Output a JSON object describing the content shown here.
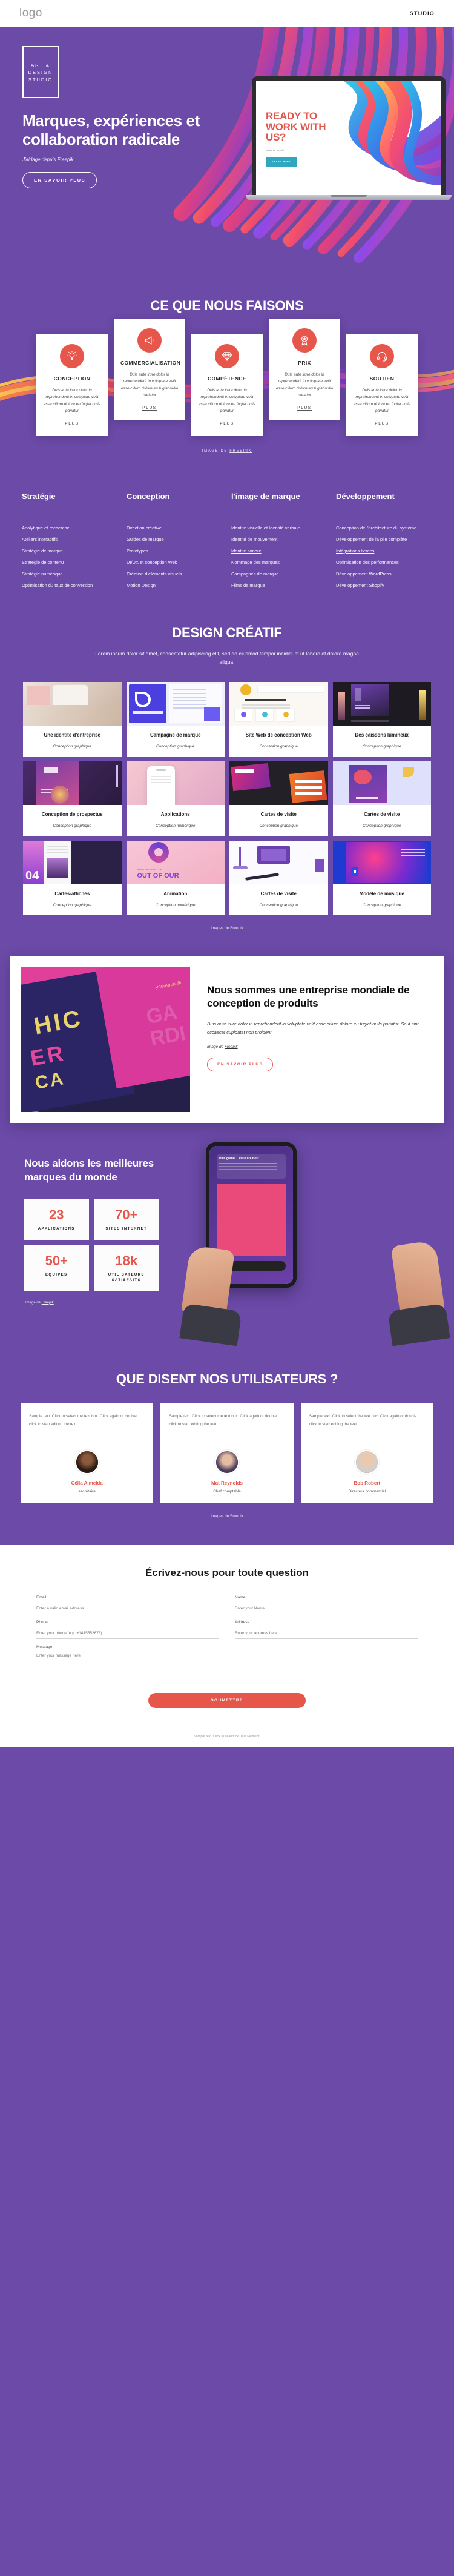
{
  "topbar": {
    "logo": "logo",
    "nav": "STUDIO"
  },
  "hero": {
    "badge": [
      "ART &",
      "DESIGN",
      "STUDIO"
    ],
    "title": "Marques, expériences et collaboration radicale",
    "credit_prefix": "J'aidage depuis ",
    "credit_link": "Freepik",
    "cta": "EN SAVOIR PLUS",
    "screen_title": "READY TO WORK WITH US?",
    "screen_sub": "image for freepik",
    "screen_btn": "LEARN MORE"
  },
  "services": {
    "title": "CE QUE NOUS FAISONS",
    "credit_prefix": "IMAGE DE ",
    "credit_link": "FREEPIK",
    "more_label": "PLUS",
    "body": "Duis aute irure dolor in reprehenderit in voluptate velit esse cillum dolore eu fugiat nulla pariatur",
    "items": [
      {
        "name": "CONCEPTION",
        "icon": "lightbulb-icon"
      },
      {
        "name": "COMMERCIALISATION",
        "icon": "megaphone-icon"
      },
      {
        "name": "COMPÉTENCE",
        "icon": "diamond-icon"
      },
      {
        "name": "PRIX",
        "icon": "award-icon"
      },
      {
        "name": "SOUTIEN",
        "icon": "headset-icon"
      }
    ]
  },
  "menus": [
    {
      "heading": "Stratégie",
      "items": [
        {
          "label": "Analytique et recherche",
          "link": false
        },
        {
          "label": "Ateliers interactifs",
          "link": false
        },
        {
          "label": "Stratégie de marque",
          "link": false
        },
        {
          "label": "Stratégie de contenu",
          "link": false
        },
        {
          "label": "Stratégie numérique",
          "link": false
        },
        {
          "label": "Optimisation du taux de conversion",
          "link": true
        }
      ]
    },
    {
      "heading": "Conception",
      "items": [
        {
          "label": "Direction créative",
          "link": false
        },
        {
          "label": "Guides de marque",
          "link": false
        },
        {
          "label": "Prototypes",
          "link": false
        },
        {
          "label": "UI/UX et conception Web",
          "link": true
        },
        {
          "label": "Création d'éléments visuels",
          "link": false
        },
        {
          "label": "Motion Design",
          "link": false
        }
      ]
    },
    {
      "heading": "l'image de marque",
      "items": [
        {
          "label": "Identité visuelle et Identité verbale",
          "link": false
        },
        {
          "label": "Identité de mouvement",
          "link": false
        },
        {
          "label": "Identité sonore",
          "link": true
        },
        {
          "label": "Nommage des marques",
          "link": false
        },
        {
          "label": "Campagnes de marque",
          "link": false
        },
        {
          "label": "Films de marque",
          "link": false
        }
      ]
    },
    {
      "heading": "Développement",
      "items": [
        {
          "label": "Conception de l'architecture du système",
          "link": false
        },
        {
          "label": "Développement de la pile complète",
          "link": false
        },
        {
          "label": "Intégrations tierces",
          "link": true
        },
        {
          "label": "Optimisation des performances",
          "link": false
        },
        {
          "label": "Développement WordPress",
          "link": false
        },
        {
          "label": "Développement Shopify",
          "link": false
        }
      ]
    }
  ],
  "portfolio": {
    "title": "DESIGN CRÉATIF",
    "subtitle": "Lorem ipsum dolor sit amet, consectetur adipiscing elit, sed do eiusmod tempor incididunt ut labore et dolore magna aliqua.",
    "credit_prefix": "Images de ",
    "credit_link": "Freepik",
    "tiles": [
      {
        "title": "Une identité d'entreprise",
        "category": "Conception graphique"
      },
      {
        "title": "Campagne de marque",
        "category": "Conception graphique"
      },
      {
        "title": "Site Web de conception Web",
        "category": "Conception graphique"
      },
      {
        "title": "Des caissons lumineux",
        "category": "Conception graphique"
      },
      {
        "title": "Conception de prospectus",
        "category": "Conception graphique"
      },
      {
        "title": "Applications",
        "category": "Conception numérique"
      },
      {
        "title": "Cartes de visite",
        "category": "Conception graphique"
      },
      {
        "title": "Cartes de visite",
        "category": "Conception graphique"
      },
      {
        "title": "Cartes-affiches",
        "category": "Conception graphique"
      },
      {
        "title": "Animation",
        "category": "Conception numérique"
      },
      {
        "title": "Cartes de visite",
        "category": "Conception graphique"
      },
      {
        "title": "Modèle de musique",
        "category": "Conception graphique"
      }
    ]
  },
  "about": {
    "title": "Nous sommes une entreprise mondiale de conception de produits",
    "text": "Duis aute irure dolor in reprehenderit in voluptate velit esse cillum dolore eu fugiat nulla pariatur. Sauf sint occaecat cupidatat non proident",
    "credit_prefix": "Image de ",
    "credit_link": "Freepik",
    "cta": "EN SAVOIR PLUS"
  },
  "stats": {
    "title": "Nous aidons les meilleures marques du monde",
    "credit_prefix": "Image de ",
    "credit_link": "Freepik",
    "items": [
      {
        "value": "23",
        "label": "APPLICATIONS"
      },
      {
        "value": "70+",
        "label": "SITES INTERNET"
      },
      {
        "value": "50+",
        "label": "ÉQUIPES"
      },
      {
        "value": "18k",
        "label": "UTILISATEURS SATISFAITS"
      }
    ]
  },
  "testimonials": {
    "title": "QUE DISENT NOS UTILISATEURS ?",
    "credit_prefix": "Images de ",
    "credit_link": "Freepik",
    "items": [
      {
        "text": "Sample text. Click to select the text box. Click again or double click to start editing the text.",
        "name": "Célia Almeida",
        "role": "secrétaire"
      },
      {
        "text": "Sample text. Click to select the text box. Click again or double click to start editing the text.",
        "name": "Mat Reynolds",
        "role": "Chef comptable"
      },
      {
        "text": "Sample text. Click to select the text box. Click again or double click to start editing the text.",
        "name": "Bob Robert",
        "role": "Directeur commercial"
      }
    ]
  },
  "form": {
    "title": "Écrivez-nous pour toute question",
    "fields": [
      {
        "label": "Email",
        "placeholder": "Enter a valid email address",
        "value": ""
      },
      {
        "label": "Name",
        "placeholder": "Enter your Name",
        "value": ""
      },
      {
        "label": "Phone",
        "placeholder": "Enter your phone (e.g. +1415552678)",
        "value": ""
      },
      {
        "label": "Address",
        "placeholder": "Enter your address here",
        "value": ""
      }
    ],
    "message_label": "Message",
    "message_placeholder": "Enter your message here",
    "submit": "SOUMETTRE"
  },
  "footer": {
    "prefix": "Sample text. Click to select the Text Element.",
    "link": ""
  },
  "colors": {
    "brand": "#6b4aa8",
    "accent": "#e6564b",
    "teal": "#2fa8bf"
  }
}
